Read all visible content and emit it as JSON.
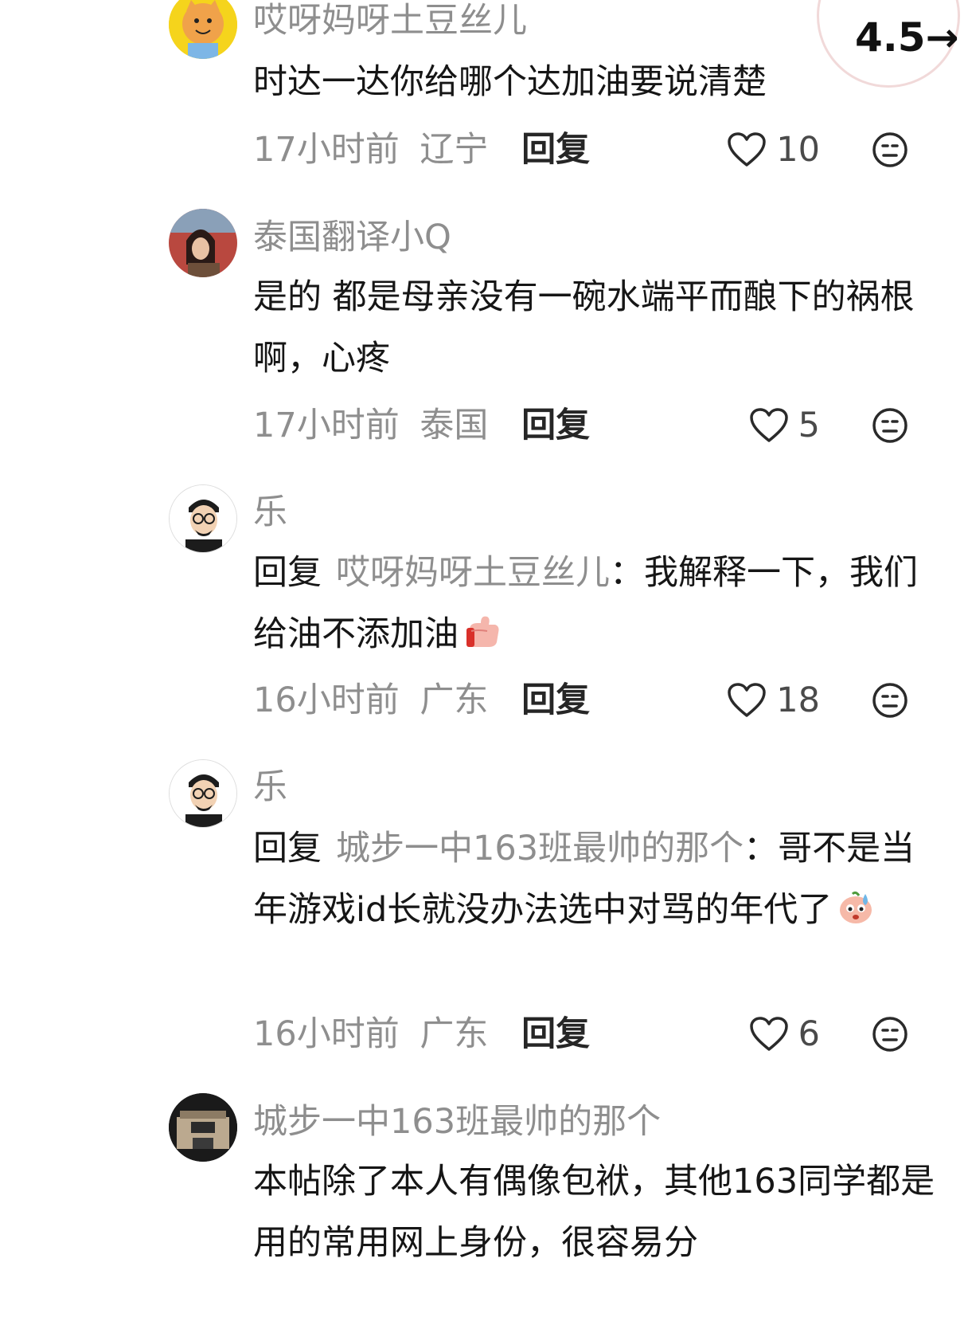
{
  "rating": {
    "value": "4.5",
    "arrow": "→"
  },
  "comments": [
    {
      "username": "哎呀妈呀土豆丝儿",
      "avatar_icon": "cartoon-cat-avatar",
      "text": "时达一达你给哪个达加油要说清楚",
      "time": "17小时前",
      "location": "辽宁",
      "reply_label": "回复",
      "likes": "10"
    },
    {
      "username": "泰国翻译小Q",
      "avatar_icon": "photo-avatar",
      "text": "是的 都是母亲没有一碗水端平而酿下的祸根啊，心疼",
      "time": "17小时前",
      "location": "泰国",
      "reply_label": "回复",
      "likes": "5"
    },
    {
      "username": "乐",
      "avatar_icon": "glasses-man-avatar",
      "reply_keyword": "回复",
      "reply_target": "哎呀妈呀土豆丝儿",
      "colon": "：",
      "text": "我解释一下，我们给油不添加油",
      "emoji_icon": "thumb-emoji-icon",
      "time": "16小时前",
      "location": "广东",
      "reply_label": "回复",
      "likes": "18"
    },
    {
      "username": "乐",
      "avatar_icon": "glasses-man-avatar",
      "reply_keyword": "回复",
      "reply_target": "城步一中163班最帅的那个",
      "colon": "：",
      "text": "哥不是当年游戏id长就没办法选中对骂的年代了",
      "emoji_icon": "sweat-face-emoji-icon",
      "time": "16小时前",
      "location": "广东",
      "reply_label": "回复",
      "likes": "6"
    },
    {
      "username": "城步一中163班最帅的那个",
      "avatar_icon": "gate-photo-avatar",
      "text": "本帖除了本人有偶像包袱，其他163同学都是用的常用网上身份，很容易分"
    }
  ],
  "colors": {
    "secondary_text": "#8e8e8e",
    "primary_text": "#161616"
  }
}
